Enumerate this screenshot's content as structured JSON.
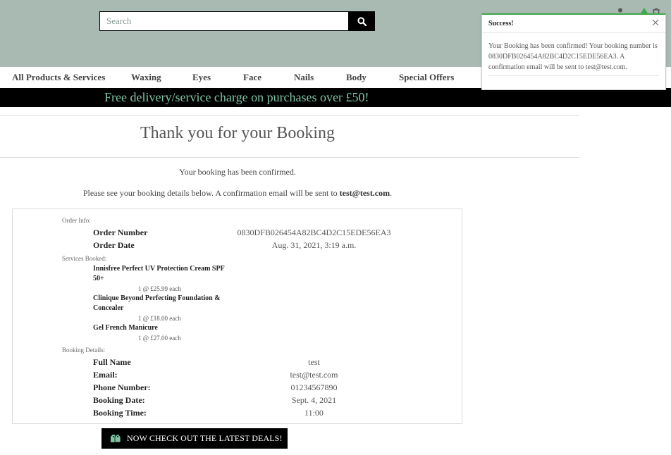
{
  "search": {
    "placeholder": "Search"
  },
  "nav": {
    "items": [
      {
        "label": "All Products & Services"
      },
      {
        "label": "Waxing"
      },
      {
        "label": "Eyes"
      },
      {
        "label": "Face"
      },
      {
        "label": "Nails"
      },
      {
        "label": "Body"
      },
      {
        "label": "Special Offers"
      }
    ]
  },
  "banner": {
    "text": "Free delivery/service charge on purchases over £50!"
  },
  "page": {
    "title": "Thank you for your Booking",
    "confirm_msg": "Your booking has been confirmed.",
    "details_msg_prefix": "Please see your booking details below. A confirmation email will be sent to ",
    "details_msg_email": "test@test.com",
    "details_msg_suffix": "."
  },
  "order": {
    "section_label": "Order Info:",
    "number_label": "Order Number",
    "number_value": "0830DFB026454A82BC4D2C15EDE56EA3",
    "date_label": "Order Date",
    "date_value": "Aug. 31, 2021, 3:19 a.m."
  },
  "services": {
    "section_label": "Services Booked:",
    "items": [
      {
        "name": "Innisfree Perfect UV Protection Cream SPF 50+",
        "qty": "1 @ £25.99 each"
      },
      {
        "name": "Clinique Beyond Perfecting Foundation & Concealer",
        "qty": "1 @ £18.00 each"
      },
      {
        "name": "Gel French Manicure",
        "qty": "1 @ £27.00 each"
      }
    ]
  },
  "booking": {
    "section_label": "Booking Details:",
    "rows": [
      {
        "label": "Full Name",
        "value": "test"
      },
      {
        "label": "Email:",
        "value": "test@test.com"
      },
      {
        "label": "Phone Number:",
        "value": "01234567890"
      },
      {
        "label": "Booking Date:",
        "value": "Sept. 4, 2021"
      },
      {
        "label": "Booking Time:",
        "value": "11:00"
      }
    ]
  },
  "cta": {
    "label": "NOW CHECK OUT THE LATEST DEALS!",
    "icon": "tags-icon"
  },
  "toast": {
    "title": "Success!",
    "body": "Your Booking has been confirmed! Your booking number is 0830DFB026454A82BC4D2C15EDE56EA3. A confirmation email will be sent to test@test.com.",
    "accent_color": "#41a84d"
  },
  "colors": {
    "header_bg": "#a8bab2",
    "banner_bg": "#000000",
    "banner_text": "#7ec4a4"
  }
}
